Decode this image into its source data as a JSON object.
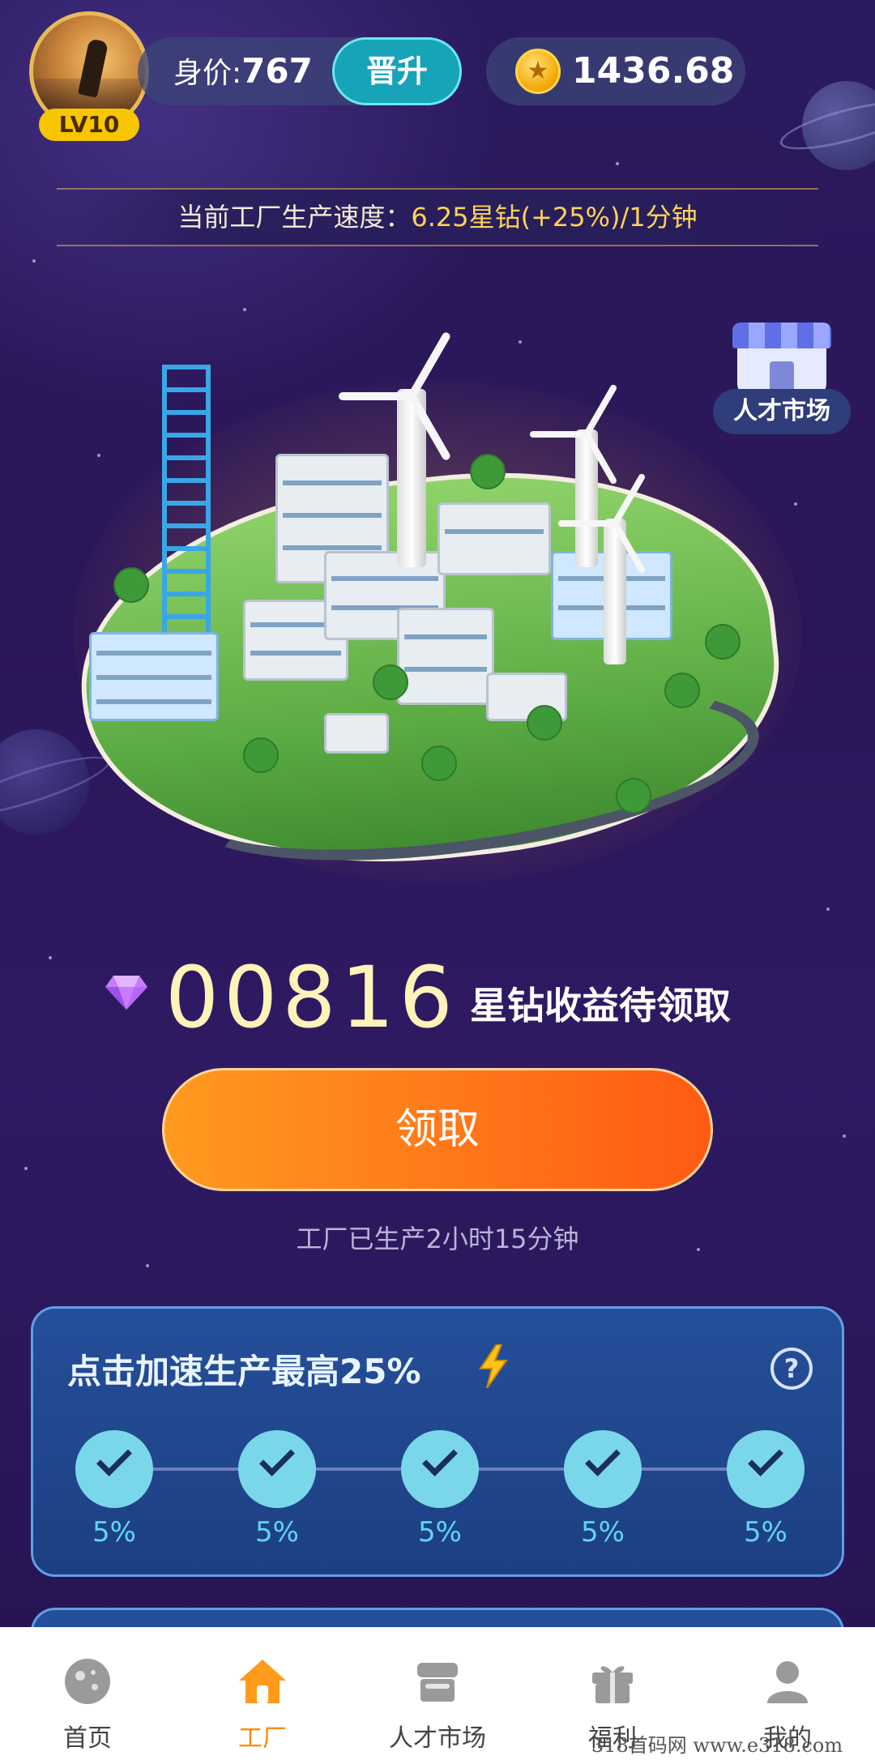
{
  "header": {
    "level": "LV10",
    "worth_label": "身价:",
    "worth_value": "767",
    "promote_label": "晋升",
    "coins": "1436.68"
  },
  "speed": {
    "label": "当前工厂生产速度：",
    "value": "6.25星钻(+25%)/1分钟"
  },
  "talent_market_float": "人才市场",
  "reward": {
    "amount": "00816",
    "label": "星钻收益待领取",
    "claim_button": "领取",
    "produced_time": "工厂已生产2小时15分钟"
  },
  "accelerate": {
    "title": "点击加速生产最高25%",
    "steps": [
      {
        "percent": "5%",
        "done": true
      },
      {
        "percent": "5%",
        "done": true
      },
      {
        "percent": "5%",
        "done": true
      },
      {
        "percent": "5%",
        "done": true
      },
      {
        "percent": "5%",
        "done": true
      }
    ]
  },
  "nav": {
    "items": [
      {
        "label": "首页",
        "icon": "planet-icon"
      },
      {
        "label": "工厂",
        "icon": "home-icon",
        "active": true
      },
      {
        "label": "人才市场",
        "icon": "shop-icon"
      },
      {
        "label": "福利",
        "icon": "gift-icon"
      },
      {
        "label": "我的",
        "icon": "user-icon"
      }
    ]
  },
  "watermark": "318首码网   www.e318.com",
  "colors": {
    "accent_orange": "#ff7a18",
    "coin_gold": "#f2a600",
    "card_blue": "#1d3f82",
    "check_cyan": "#7ad7ea"
  }
}
